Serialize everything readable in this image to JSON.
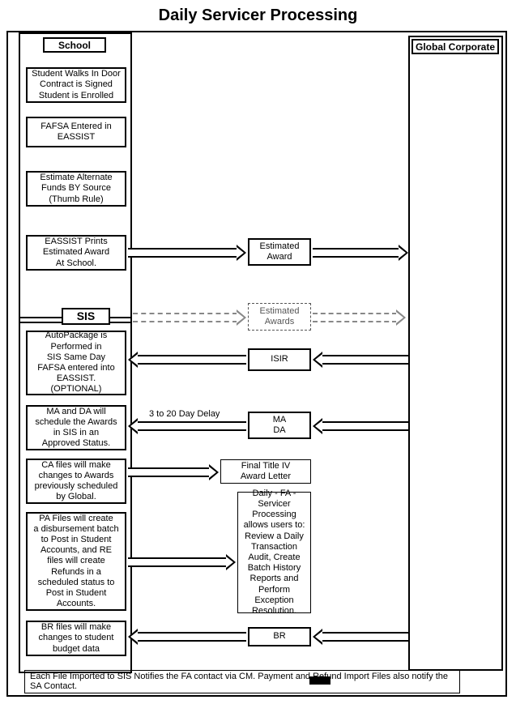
{
  "title": "Daily Servicer Processing",
  "lanes": {
    "school": "School",
    "global": "Global Corporate",
    "sis": "SIS"
  },
  "boxes": {
    "s1": "Student Walks In Door\nContract is Signed\nStudent is Enrolled",
    "s2": "FAFSA Entered in\nEASSIST",
    "s3": "Estimate Alternate\nFunds BY Source\n(Thumb Rule)",
    "s4": "EASSIST Prints\nEstimated Award\nAt School.",
    "sis1": "AutoPackage is\nPerformed in\nSIS Same Day\nFAFSA entered into\nEASSIST.\n(OPTIONAL)",
    "sis2": "MA and  DA will\nschedule the Awards\nin SIS in an\nApproved Status.",
    "sis3": "CA files will make\nchanges to Awards\npreviously scheduled\nby Global.",
    "sis4": "PA Files will create\na disbursement batch\nto Post in Student\nAccounts, and  RE\nfiles will create\nRefunds in a\nscheduled status to\nPost in Student\nAccounts.",
    "sis5": "BR files will make\nchanges to student\nbudget data",
    "m1": "Estimated\nAward",
    "m2": "Estimated\nAwards",
    "m3": "ISIR",
    "m4": "MA\nDA",
    "m5": "Final Title IV\nAward Letter",
    "m6": "Daily - FA -\nServicer\nProcessing\nallows users to:\nReview a Daily\nTransaction\nAudit, Create\nBatch History\nReports and\nPerform\nException\nResolution.",
    "m7": "BR"
  },
  "arrow_labels": {
    "delay": "3 to 20 Day Delay"
  },
  "footnote": "Each File Imported to SIS Notifies the FA contact via CM.\nPayment and Refund Import Files also notify the SA Contact."
}
